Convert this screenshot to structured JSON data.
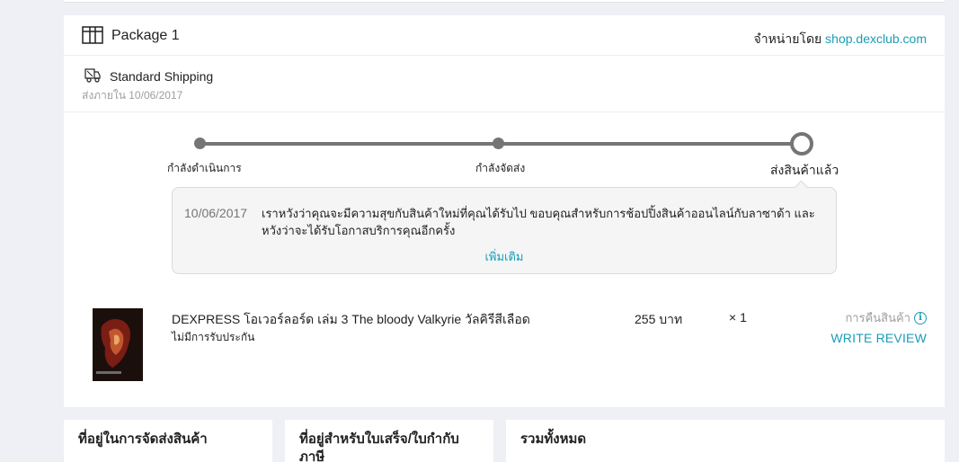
{
  "package": {
    "title": "Package 1",
    "seller_prefix": "จำหน่ายโดย",
    "seller_link": "shop.dexclub.com"
  },
  "shipping": {
    "method": "Standard Shipping",
    "deliver_by": "ส่งภายใน 10/06/2017"
  },
  "timeline": {
    "steps": [
      {
        "label": "กำลังดำเนินการ"
      },
      {
        "label": "กำลังจัดส่ง"
      },
      {
        "label": "ส่งสินค้าแล้ว"
      }
    ],
    "current_step": 3,
    "message": {
      "date": "10/06/2017",
      "text": "เราหวังว่าคุณจะมีความสุขกับสินค้าใหม่ที่คุณได้รับไป ขอบคุณสำหรับการช้อปปิ้งสินค้าออนไลน์กับลาซาด้า และหวังว่าจะได้รับโอกาสบริการคุณอีกครั้ง",
      "more_label": "เพิ่มเติม"
    }
  },
  "item": {
    "name": "DEXPRESS โอเวอร์ลอร์ด เล่ม 3 The bloody Valkyrie วัลคิรีสีเลือด",
    "warranty": "ไม่มีการรับประกัน",
    "price": "255 บาท",
    "quantity": "× 1",
    "return_label": "การคืนสินค้า",
    "review_label": "WRITE REVIEW"
  },
  "bottom_sections": {
    "shipping_address_title": "ที่อยู่ในการจัดส่งสินค้า",
    "billing_address_title": "ที่อยู่สำหรับใบเสร็จ/ใบกำกับภาษี",
    "total_title": "รวมทั้งหมด"
  },
  "colors": {
    "accent": "#1a9cb7",
    "timeline": "#757575",
    "background": "#eff0f5"
  },
  "icons": {
    "package": "package-icon",
    "shipping": "truck-icon",
    "info": "info-icon"
  }
}
